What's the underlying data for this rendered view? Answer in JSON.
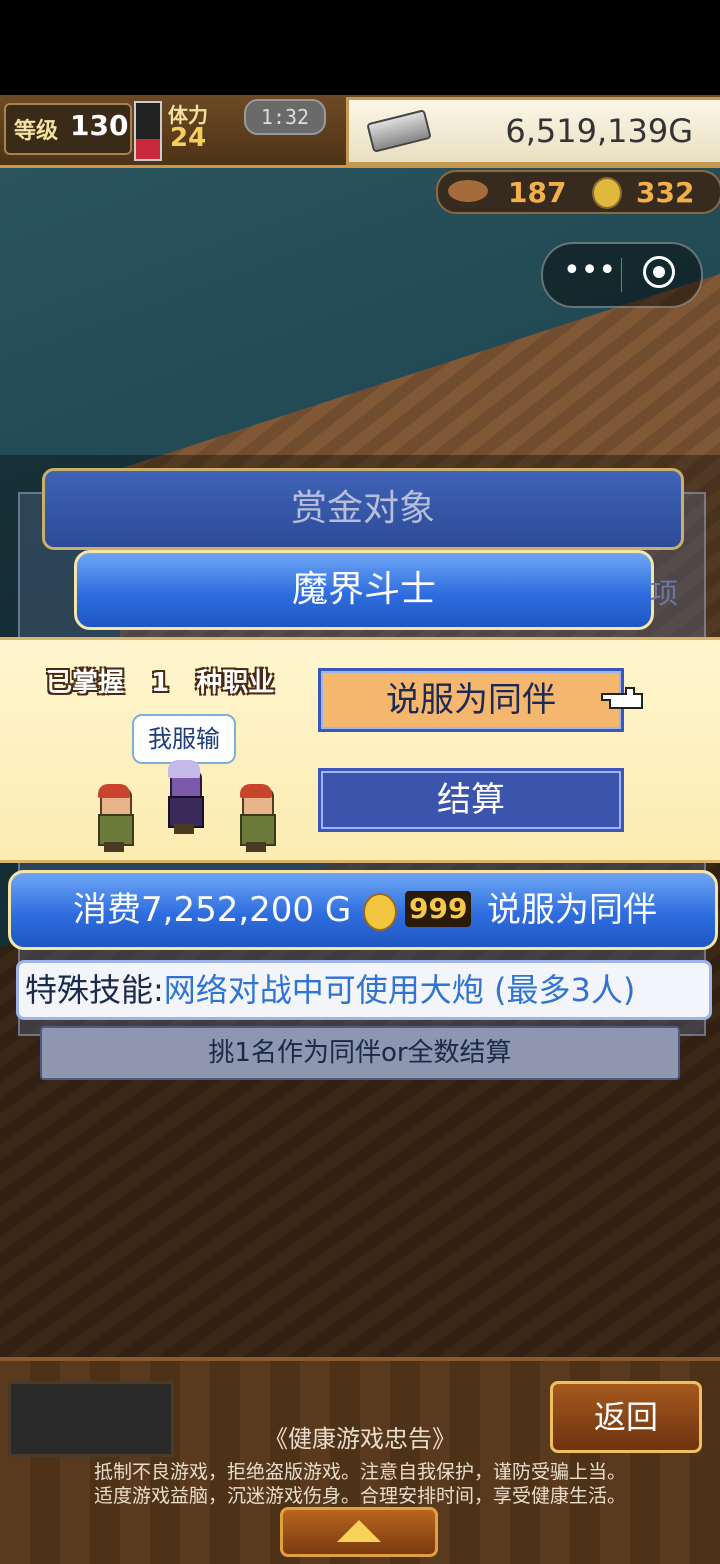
{
  "hud": {
    "level_label": "等级",
    "level_value": "130",
    "stamina_label": "体力",
    "stamina_value": "24",
    "timer": "1:32",
    "gold": "6,519,139G",
    "hp_fraction": 0.35,
    "resource_1": "187",
    "resource_2": "332"
  },
  "capsule": {
    "more_icon": "more-dots-icon",
    "close_icon": "target-close-icon"
  },
  "modal": {
    "title": "赏金对象",
    "job_name": "魔界斗士",
    "ghost_char": "项",
    "mastered": [
      "已掌握",
      "1",
      "种职业"
    ],
    "speech": "我服输",
    "recruit_button": "说服为同伴",
    "settle_button": "结算",
    "cost_text": "消费7,252,200 G",
    "coin_count": "999",
    "cost_action": "说服为同伴",
    "skill_label": "特殊技能:",
    "skill_value": "网络对战中可使用大炮 (最多3人)",
    "hint": "挑1名作为同伴or全数结算"
  },
  "footer": {
    "back_button": "返回",
    "advisory_title": "《健康游戏忠告》",
    "advisory_line1": "抵制不良游戏，拒绝盗版游戏。注意自我保护，谨防受骗上当。",
    "advisory_line2": "适度游戏益脑，沉迷游戏伤身。合理安排时间，享受健康生活。"
  },
  "colors": {
    "accent_blue": "#2f6ee0",
    "recruit_orange": "#f4b76d",
    "band_cream": "#fff6cf"
  }
}
